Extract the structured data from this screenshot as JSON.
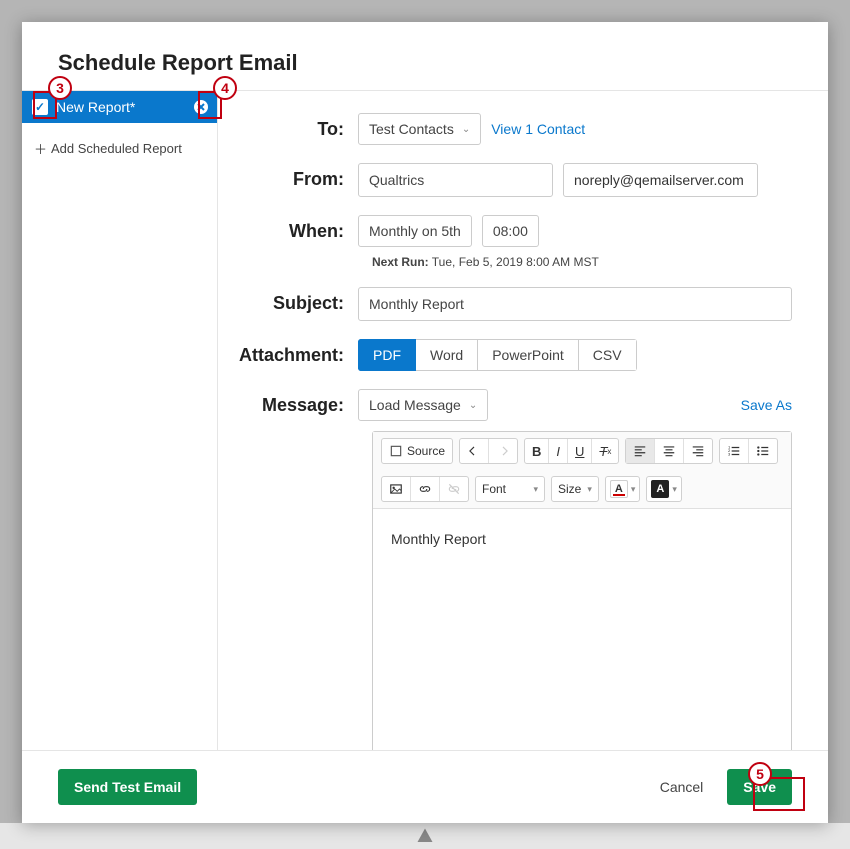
{
  "title": "Schedule Report Email",
  "sidebar": {
    "report_name": "New Report*",
    "add_label": "Add Scheduled Report"
  },
  "labels": {
    "to": "To:",
    "from": "From:",
    "when": "When:",
    "subject": "Subject:",
    "attachment": "Attachment:",
    "message": "Message:"
  },
  "to": {
    "dropdown": "Test Contacts",
    "link": "View 1 Contact"
  },
  "from": {
    "name": "Qualtrics",
    "email": "noreply@qemailserver.com"
  },
  "when": {
    "freq": "Monthly on 5th",
    "time": "08:00",
    "next_label": "Next Run:",
    "next_value": "Tue, Feb 5, 2019 8:00 AM MST"
  },
  "subject": "Monthly Report",
  "attachment": {
    "options": [
      "PDF",
      "Word",
      "PowerPoint",
      "CSV"
    ],
    "active": "PDF"
  },
  "message": {
    "load": "Load Message",
    "save_as": "Save As",
    "source": "Source",
    "font": "Font",
    "size": "Size",
    "body": "Monthly Report"
  },
  "footer": {
    "send_test": "Send Test Email",
    "cancel": "Cancel",
    "save": "Save"
  },
  "callouts": {
    "c3": "3",
    "c4": "4",
    "c5": "5"
  }
}
